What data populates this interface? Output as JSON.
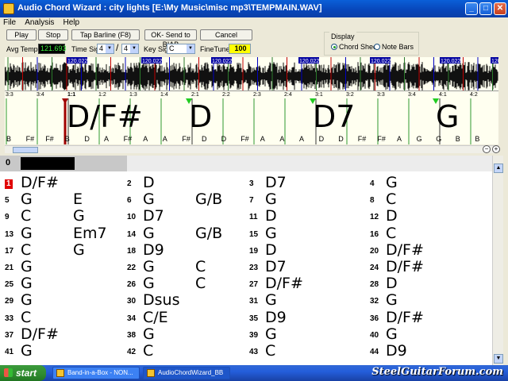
{
  "window": {
    "title": "Audio Chord Wizard : city lights [E:\\My Music\\misc mp3\\TEMPMAIN.WAV]",
    "min_label": "_",
    "max_label": "□",
    "close_label": "✕"
  },
  "menu": [
    "File",
    "Analysis",
    "Help"
  ],
  "toolbar": {
    "play": "Play",
    "stop": "Stop",
    "tap_barline": "Tap Barline (F8)",
    "ok_send": "OK- Send to BIAB",
    "cancel": "Cancel",
    "avg_tempo_label": "Avg Tempo",
    "avg_tempo_value": "121.693",
    "time_sig_label": "Time Sig",
    "time_sig_num": "4",
    "time_sig_sep": "/",
    "time_sig_den": "4",
    "key_sig_label": "Key Sig",
    "key_sig_value": "C",
    "finetune_label": "FineTune",
    "finetune_value": "100"
  },
  "display": {
    "group_label": "Display",
    "chord_sheet": "Chord Sheet",
    "note_bars": "Note Bars",
    "selected": "Chord Sheet"
  },
  "waveform": {
    "tempo_markers": [
      "120.022",
      "120.022",
      "120.022",
      "120.022",
      "120.022",
      "120.022",
      "120.022"
    ]
  },
  "ruler": [
    "3:3",
    "3:4",
    "1:1",
    "1:2",
    "1:3",
    "1:4",
    "2:1",
    "2:2",
    "2:3",
    "2:4",
    "3:1",
    "3:2",
    "3:3",
    "3:4",
    "4:1",
    "4:2"
  ],
  "strip": {
    "chords": [
      "D/F#",
      "D",
      "D7",
      "G"
    ],
    "notes": [
      "B",
      "F#",
      "F#",
      "B",
      "D",
      "A",
      "F#",
      "A",
      "A",
      "F#",
      "D",
      "D",
      "F#",
      "A",
      "A",
      "A",
      "D",
      "D",
      "F#",
      "F#",
      "A",
      "G",
      "G",
      "B",
      "B"
    ]
  },
  "position": {
    "bar": "0"
  },
  "sheet": {
    "cells": [
      {
        "n": "1",
        "c1": "D/F#",
        "c2": ""
      },
      {
        "n": "2",
        "c1": "D",
        "c2": ""
      },
      {
        "n": "3",
        "c1": "D7",
        "c2": ""
      },
      {
        "n": "4",
        "c1": "G",
        "c2": ""
      },
      {
        "n": "5",
        "c1": "G",
        "c2": "E"
      },
      {
        "n": "6",
        "c1": "G",
        "c2": "G/B"
      },
      {
        "n": "7",
        "c1": "G",
        "c2": ""
      },
      {
        "n": "8",
        "c1": "C",
        "c2": ""
      },
      {
        "n": "9",
        "c1": "C",
        "c2": "G"
      },
      {
        "n": "10",
        "c1": "D7",
        "c2": ""
      },
      {
        "n": "11",
        "c1": "D",
        "c2": ""
      },
      {
        "n": "12",
        "c1": "D",
        "c2": ""
      },
      {
        "n": "13",
        "c1": "G",
        "c2": "Em7"
      },
      {
        "n": "14",
        "c1": "G",
        "c2": "G/B"
      },
      {
        "n": "15",
        "c1": "G",
        "c2": ""
      },
      {
        "n": "16",
        "c1": "C",
        "c2": ""
      },
      {
        "n": "17",
        "c1": "C",
        "c2": "G"
      },
      {
        "n": "18",
        "c1": "D9",
        "c2": ""
      },
      {
        "n": "19",
        "c1": "D",
        "c2": ""
      },
      {
        "n": "20",
        "c1": "D/F#",
        "c2": ""
      },
      {
        "n": "21",
        "c1": "G",
        "c2": ""
      },
      {
        "n": "22",
        "c1": "G",
        "c2": "C"
      },
      {
        "n": "23",
        "c1": "D7",
        "c2": ""
      },
      {
        "n": "24",
        "c1": "D/F#",
        "c2": ""
      },
      {
        "n": "25",
        "c1": "G",
        "c2": ""
      },
      {
        "n": "26",
        "c1": "G",
        "c2": "C"
      },
      {
        "n": "27",
        "c1": "D/F#",
        "c2": ""
      },
      {
        "n": "28",
        "c1": "D",
        "c2": ""
      },
      {
        "n": "29",
        "c1": "G",
        "c2": ""
      },
      {
        "n": "30",
        "c1": "Dsus",
        "c2": ""
      },
      {
        "n": "31",
        "c1": "G",
        "c2": ""
      },
      {
        "n": "32",
        "c1": "G",
        "c2": ""
      },
      {
        "n": "33",
        "c1": "C",
        "c2": ""
      },
      {
        "n": "34",
        "c1": "C/E",
        "c2": ""
      },
      {
        "n": "35",
        "c1": "D9",
        "c2": ""
      },
      {
        "n": "36",
        "c1": "D/F#",
        "c2": ""
      },
      {
        "n": "37",
        "c1": "D/F#",
        "c2": ""
      },
      {
        "n": "38",
        "c1": "G",
        "c2": ""
      },
      {
        "n": "39",
        "c1": "G",
        "c2": ""
      },
      {
        "n": "40",
        "c1": "G",
        "c2": ""
      },
      {
        "n": "41",
        "c1": "G",
        "c2": ""
      },
      {
        "n": "42",
        "c1": "C",
        "c2": ""
      },
      {
        "n": "43",
        "c1": "C",
        "c2": ""
      },
      {
        "n": "44",
        "c1": "D9",
        "c2": ""
      }
    ]
  },
  "taskbar": {
    "start": "start",
    "tasks": [
      "Band-in-a-Box - NON...",
      "AudioChordWizard_BB"
    ],
    "watermark": "SteelGuitarForum.com"
  }
}
